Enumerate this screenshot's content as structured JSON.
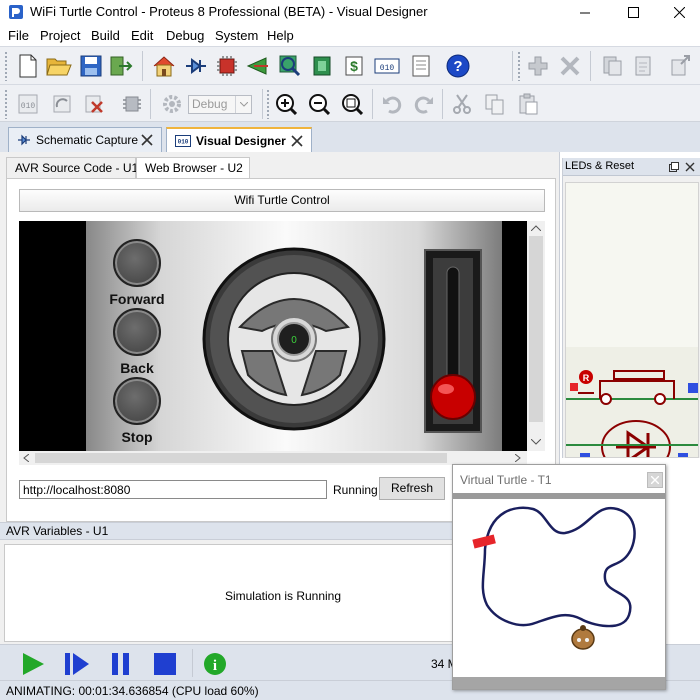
{
  "window": {
    "title": "WiFi Turtle Control - Proteus 8 Professional (BETA) - Visual Designer"
  },
  "menu": [
    "File",
    "Project",
    "Build",
    "Edit",
    "Debug",
    "System",
    "Help"
  ],
  "toolbar": {
    "build_config": "Debug",
    "icons_row1": [
      "new-file",
      "open-folder",
      "save",
      "close-project",
      "home",
      "schematic-capture",
      "pcb-layout",
      "3d-visualizer",
      "gerber-viewer",
      "design-explorer",
      "bill-of-materials",
      "source-code",
      "project-notes",
      "help",
      "add-sheet",
      "remove-sheet",
      "copy-sheet",
      "paste-sheet",
      "export-sheet"
    ],
    "icons_row2": [
      "build-project",
      "rebuild-project",
      "clean-project",
      "chip",
      "settings",
      "zoom-in",
      "zoom-out",
      "zoom-area",
      "undo",
      "redo",
      "cut",
      "copy",
      "paste"
    ]
  },
  "tabs": [
    {
      "label": "Schematic Capture",
      "icon": "schematic-icon"
    },
    {
      "label": "Visual Designer",
      "icon": "visual-designer-icon",
      "active": true
    }
  ],
  "left_panel": {
    "subtabs": [
      {
        "label": "AVR Source Code - U1"
      },
      {
        "label": "Web Browser - U2",
        "active": true
      }
    ],
    "web_page": {
      "title": "Wifi Turtle Control",
      "buttons": [
        {
          "label": "Forward"
        },
        {
          "label": "Back"
        },
        {
          "label": "Stop"
        }
      ],
      "speed_value": "0"
    },
    "url": "http://localhost:8080",
    "status": "Running",
    "refresh_label": "Refresh"
  },
  "right_panel": {
    "title": "LEDs & Reset"
  },
  "avr_panel": {
    "title": "AVR Variables - U1",
    "message": "Simulation is Running"
  },
  "playback": {
    "controls": [
      "play",
      "step",
      "pause",
      "stop"
    ],
    "memory_text": "34 M"
  },
  "status_bar": {
    "text": "ANIMATING: 00:01:34.636854 (CPU load 60%)"
  },
  "virtual_turtle": {
    "title": "Virtual Turtle - T1"
  },
  "colors": {
    "accent_orange": "#f0b43c",
    "play_green": "#22a829",
    "control_blue": "#1f3fd0",
    "track_navy": "#1a1f5e",
    "marker_red": "#e6252a"
  }
}
